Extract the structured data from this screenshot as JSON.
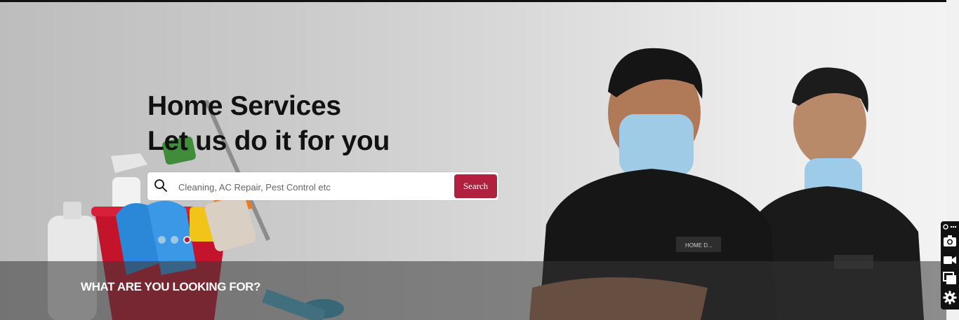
{
  "hero": {
    "headline_line1": "Home Services",
    "headline_line2": "Let us do it for you",
    "search": {
      "placeholder": "Cleaning, AC Repair, Pest Control etc",
      "button_label": "Search"
    },
    "carousel": {
      "slide_count": 3,
      "active_slide": 3
    },
    "section_title": "WHAT ARE YOU LOOKING FOR?",
    "shirt_logo_text": "HOME D..."
  },
  "colors": {
    "accent": "#b0213f",
    "dot_inactive": "#9fc6e2",
    "band_overlay": "rgba(55,55,55,0.55)"
  },
  "side_toolbar": {
    "icons": [
      "link-more-icon",
      "camera-icon",
      "video-icon",
      "window-icon",
      "gear-icon"
    ]
  }
}
